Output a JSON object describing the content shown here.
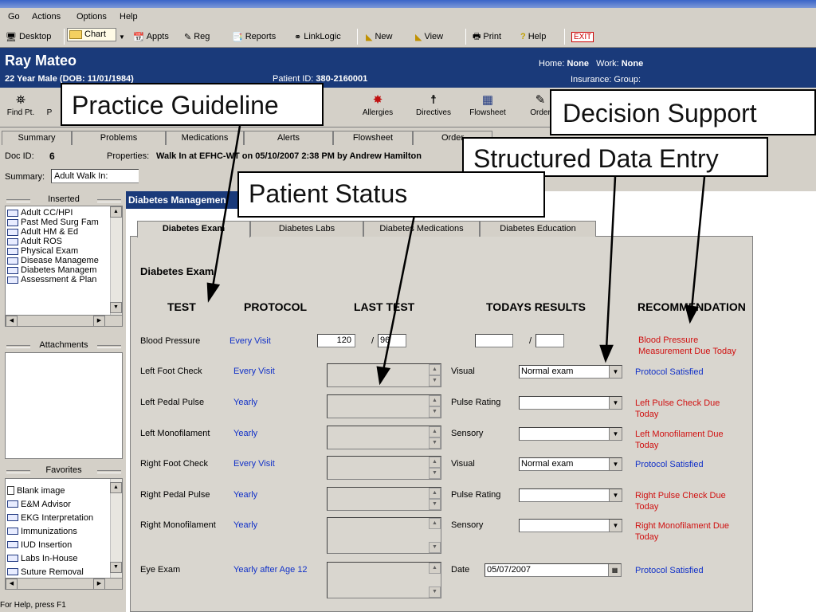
{
  "menu": {
    "go": "Go",
    "actions": "Actions",
    "options": "Options",
    "help": "Help"
  },
  "toolbar": {
    "desktop": "Desktop",
    "chart": "Chart",
    "appts": "Appts",
    "reg": "Reg",
    "reports": "Reports",
    "linklogic": "LinkLogic",
    "new": "New",
    "view": "View",
    "print": "Print",
    "help": "Help",
    "exit": "EXIT"
  },
  "patient": {
    "name": "Ray Mateo",
    "line": "22 Year Male (DOB: 11/01/1984)",
    "id_label": "Patient ID:",
    "id_value": "380-2160001",
    "home_label": "Home:",
    "home_value": "None",
    "work_label": "Work:",
    "work_value": "None",
    "insurance": "Insurance:  Group:"
  },
  "toolbar2": {
    "findpt": "Find Pt.",
    "p": "P",
    "allergies": "Allergies",
    "directives": "Directives",
    "flowsheet": "Flowsheet",
    "orders": "Order"
  },
  "tabs": [
    "Summary",
    "Problems",
    "Medications",
    "Alerts",
    "Flowsheet",
    "Order"
  ],
  "doc": {
    "id_label": "Doc ID:",
    "id_value": "6",
    "props_label": "Properties:",
    "props_value": "Walk In at EFHC-WT on 05/10/2007 2:38 PM by Andrew Hamilton",
    "summary_label": "Summary:",
    "summary_value": "Adult Walk In:"
  },
  "inserted": {
    "title": "Inserted",
    "items": [
      "Adult CC/HPI",
      "Past Med Surg Fam",
      "Adult HM & Ed",
      "Adult ROS",
      "Physical Exam",
      "Disease Manageme",
      "Diabetes Managem",
      "Assessment & Plan"
    ]
  },
  "attachments": {
    "title": "Attachments"
  },
  "favorites": {
    "title": "Favorites",
    "items": [
      "Blank image",
      "E&M Advisor",
      "EKG Interpretation",
      "Immunizations",
      "IUD Insertion",
      "Labs In-House",
      "Suture Removal"
    ]
  },
  "form": {
    "title": "Diabetes Managemen",
    "tabs": [
      "Diabetes Exam",
      "Diabetes Labs",
      "Diabetes Medications",
      "Diabetes Education"
    ],
    "heading": "Diabetes Exam",
    "columns": [
      "TEST",
      "PROTOCOL",
      "LAST TEST",
      "TODAYS RESULTS",
      "RECOMMENDATION"
    ],
    "bp": {
      "test": "Blood Pressure",
      "protocol": "Every Visit",
      "sys": "120",
      "slash": "/",
      "dia": "96",
      "rec": "Blood Pressure Measurement Due Today"
    },
    "rows": [
      {
        "test": "Left Foot Check",
        "protocol": "Every Visit",
        "result_label": "Visual",
        "result_value": "Normal exam",
        "rec": "Protocol Satisfied"
      },
      {
        "test": "Left Pedal Pulse",
        "protocol": "Yearly",
        "result_label": "Pulse Rating",
        "result_value": "",
        "rec": "Left Pulse Check Due Today"
      },
      {
        "test": "Left Monofilament",
        "protocol": "Yearly",
        "result_label": "Sensory",
        "result_value": "",
        "rec": "Left Monofilament Due Today"
      },
      {
        "test": "Right Foot Check",
        "protocol": "Every Visit",
        "result_label": "Visual",
        "result_value": "Normal exam",
        "rec": "Protocol Satisfied"
      },
      {
        "test": "Right Pedal Pulse",
        "protocol": "Yearly",
        "result_label": "Pulse Rating",
        "result_value": "",
        "rec": "Right Pulse Check Due Today"
      },
      {
        "test": "Right Monofilament",
        "protocol": "Yearly",
        "result_label": "Sensory",
        "result_value": "",
        "rec": "Right Monofilament Due Today"
      },
      {
        "test": "Eye Exam",
        "protocol": "Yearly after Age 12",
        "result_label": "Date",
        "result_value": "05/07/2007",
        "rec": "Protocol Satisfied"
      }
    ]
  },
  "callouts": {
    "practice": "Practice Guideline",
    "decision": "Decision Support",
    "structured": "Structured Data Entry",
    "status": "Patient Status"
  },
  "statusbar": "For Help, press F1",
  "colors": {
    "banner": "#1a3a7a",
    "protocol_blue": "#1030c8",
    "due_red": "#d01010"
  }
}
